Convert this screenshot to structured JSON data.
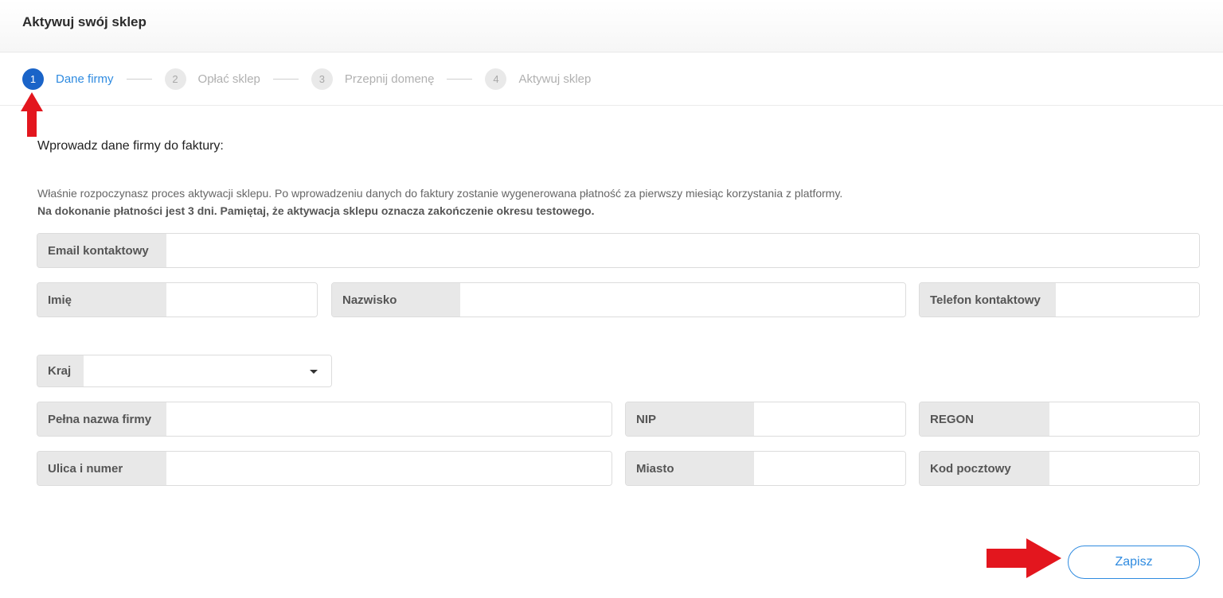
{
  "header": {
    "title": "Aktywuj swój sklep"
  },
  "stepper": {
    "steps": [
      {
        "num": "1",
        "label": "Dane firmy"
      },
      {
        "num": "2",
        "label": "Opłać sklep"
      },
      {
        "num": "3",
        "label": "Przepnij domenę"
      },
      {
        "num": "4",
        "label": "Aktywuj sklep"
      }
    ],
    "active_step": 1
  },
  "form": {
    "heading": "Wprowadz dane firmy do faktury:",
    "intro_text": "Właśnie rozpoczynasz proces aktywacji sklepu. Po wprowadzeniu danych do faktury zostanie wygenerowana płatność za pierwszy miesiąc korzystania z platformy.",
    "intro_bold": "Na dokonanie płatności jest 3 dni. Pamiętaj, że aktywacja sklepu oznacza zakończenie okresu testowego.",
    "fields": {
      "email": {
        "label": "Email kontaktowy",
        "value": ""
      },
      "first_name": {
        "label": "Imię",
        "value": ""
      },
      "last_name": {
        "label": "Nazwisko",
        "value": ""
      },
      "phone": {
        "label": "Telefon kontaktowy",
        "value": ""
      },
      "country": {
        "label": "Kraj",
        "value": ""
      },
      "company_name": {
        "label": "Pełna nazwa firmy",
        "value": ""
      },
      "nip": {
        "label": "NIP",
        "value": ""
      },
      "regon": {
        "label": "REGON",
        "value": ""
      },
      "street": {
        "label": "Ulica i numer",
        "value": ""
      },
      "city": {
        "label": "Miasto",
        "value": ""
      },
      "postal_code": {
        "label": "Kod pocztowy",
        "value": ""
      }
    },
    "save_label": "Zapisz"
  },
  "colors": {
    "accent": "#2f8be0",
    "active_step": "#1a64c8",
    "annotation_arrow": "#e3161e",
    "label_bg": "#e8e8e8"
  },
  "annotations": [
    "red-arrow-up",
    "red-arrow-right"
  ]
}
